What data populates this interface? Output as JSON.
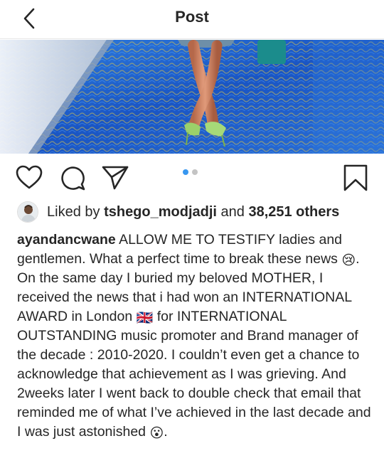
{
  "header": {
    "title": "Post"
  },
  "carousel": {
    "slide_count": 2,
    "active_index": 0
  },
  "likes": {
    "prefix": "Liked by ",
    "user": "tshego_modjadji",
    "middle": " and ",
    "count": "38,251 others"
  },
  "caption": {
    "username": "ayandancwane",
    "part1": " ALLOW ME TO TESTIFY ladies and gentlemen. What a perfect time to break these news ",
    "emoji1": "😢",
    "part2": ". On the same day I buried my beloved MOTHER, I received the news that i had won an INTERNATIONAL AWARD in London ",
    "emoji2": "🇬🇧",
    "part3": " for INTERNATIONAL OUTSTANDING music promoter and Brand manager of the decade : 2010-2020. I couldn’t even get a chance to acknowledge that achievement as I was grieving. And 2weeks later I went back to double check that email that reminded me of what I’ve achieved in the last decade and I was just astonished ",
    "emoji3": "😮",
    "part4": "."
  },
  "colors": {
    "accent": "#3897f0",
    "text": "#262626",
    "stage_blue": "#1e5fc7"
  },
  "icons": [
    "back-arrow-icon",
    "heart-icon",
    "comment-icon",
    "share-icon",
    "bookmark-icon"
  ]
}
